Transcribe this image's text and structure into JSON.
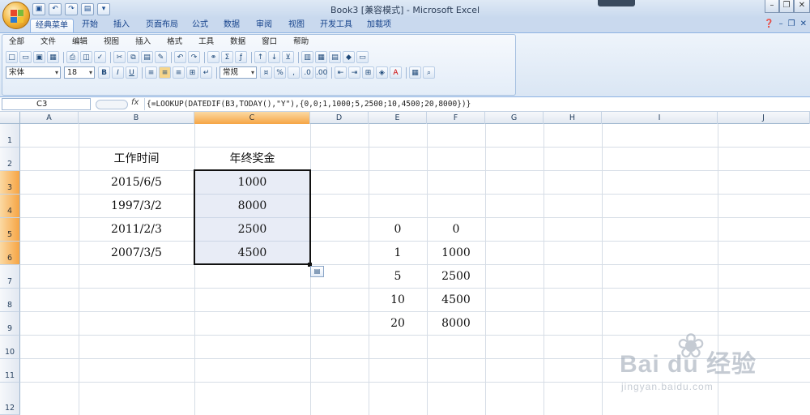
{
  "window": {
    "title": "Book3  [兼容模式] - Microsoft Excel",
    "min_label": "–",
    "restore_label": "❐",
    "close_label": "✕"
  },
  "qat": {
    "save_icon": "save-icon",
    "undo_icon": "undo-icon",
    "redo_icon": "redo-icon"
  },
  "ribbon_tabs": [
    "经典菜单",
    "开始",
    "插入",
    "页面布局",
    "公式",
    "数据",
    "审阅",
    "视图",
    "开发工具",
    "加载项"
  ],
  "active_tab": "经典菜单",
  "menu_items": [
    "全部",
    "文件",
    "编辑",
    "视图",
    "插入",
    "格式",
    "工具",
    "数据",
    "窗口",
    "帮助"
  ],
  "font": {
    "name": "宋体",
    "size": "18"
  },
  "format": {
    "number_format": "常规",
    "bold": "B",
    "italic": "I",
    "underline": "U",
    "currency": "%",
    "comma": ","
  },
  "formula_bar": {
    "name_box": "C3",
    "fx_label": "fx",
    "formula": "{=LOOKUP(DATEDIF(B3,TODAY(),\"Y\"),{0,0;1,1000;5,2500;10,4500;20,8000})}"
  },
  "sheet": {
    "columns": [
      "A",
      "B",
      "C",
      "D",
      "E",
      "F",
      "G",
      "H",
      "I",
      "J"
    ],
    "selected_column": "C",
    "rows": [
      "1",
      "2",
      "3",
      "4",
      "5",
      "6",
      "7",
      "8",
      "9",
      "10",
      "11",
      "12"
    ],
    "selected_rows": [
      "3",
      "4",
      "5",
      "6"
    ],
    "cells": {
      "B2": "工作时间",
      "C2": "年终奖金",
      "B3": "2015/6/5",
      "C3": "1000",
      "B4": "1997/3/2",
      "C4": "8000",
      "B5": "2011/2/3",
      "C5": "2500",
      "B6": "2007/3/5",
      "C6": "4500",
      "E5": "0",
      "F5": "0",
      "E6": "1",
      "F6": "1000",
      "E7": "5",
      "F7": "2500",
      "E8": "10",
      "F8": "4500",
      "E9": "20",
      "F9": "8000"
    }
  },
  "watermark": {
    "brand": "Bai du 经验",
    "url": "jingyan.baidu.com"
  },
  "colors": {
    "selection_header": "#f6a544",
    "ribbon_bg": "#dae6f4",
    "accent": "#15428b"
  }
}
